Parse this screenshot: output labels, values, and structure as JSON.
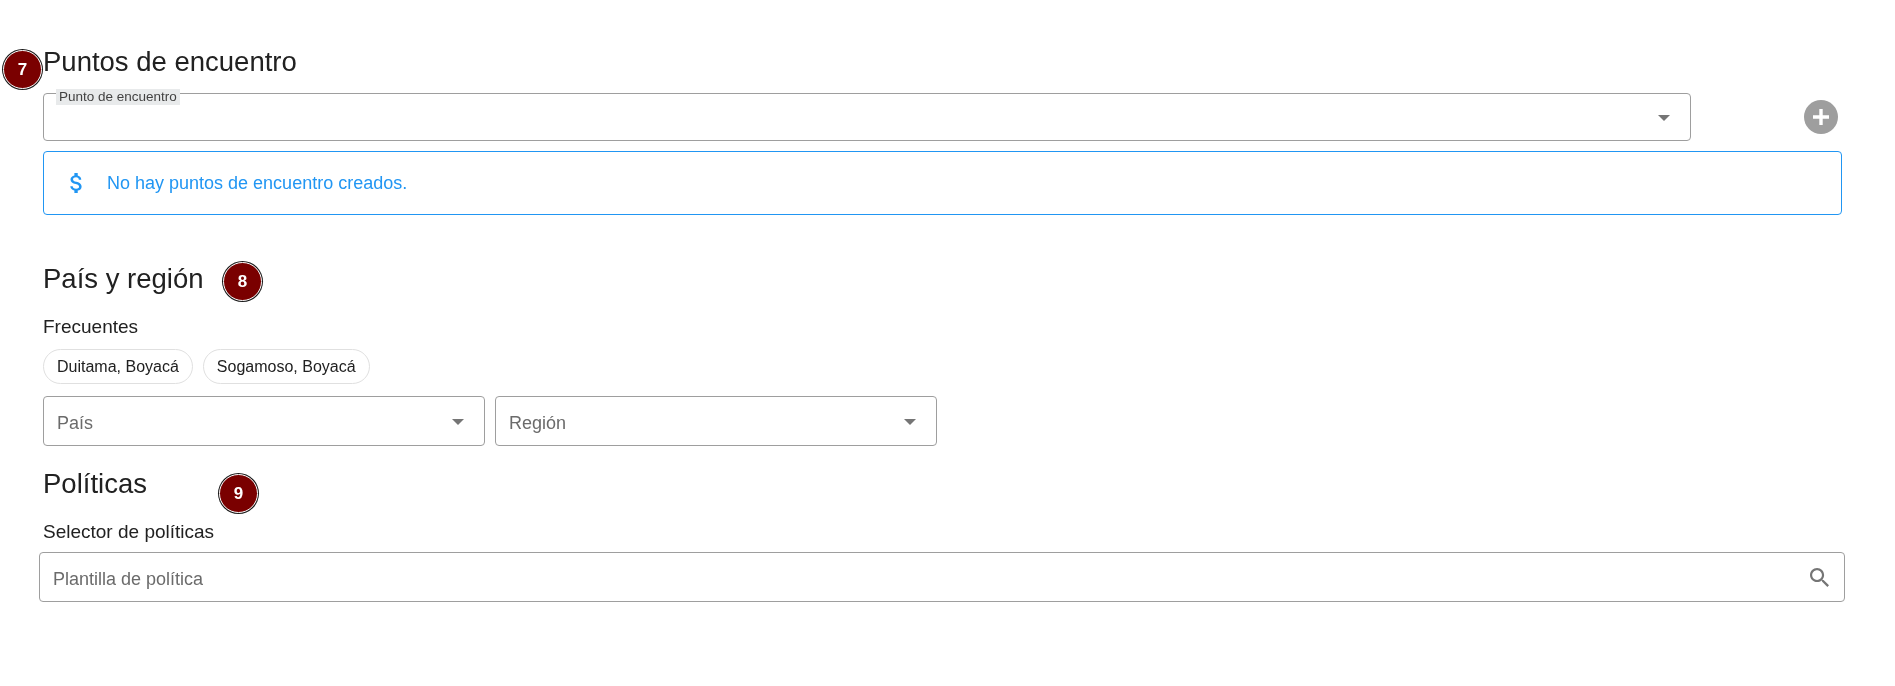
{
  "meeting_points": {
    "marker": "7",
    "title": "Puntos de encuentro",
    "field": {
      "label": "Punto de encuentro"
    },
    "alert": {
      "text": "No hay puntos de encuentro creados."
    }
  },
  "country_region": {
    "marker": "8",
    "title": "País y región",
    "frequent": {
      "label": "Frecuentes",
      "chips": [
        "Duitama, Boyacá",
        "Sogamoso, Boyacá"
      ]
    },
    "fields": [
      {
        "placeholder": "País"
      },
      {
        "placeholder": "Región"
      }
    ]
  },
  "policies": {
    "marker": "9",
    "title": "Políticas",
    "label": "Selector de políticas",
    "search": {
      "placeholder": "Plantilla de política"
    }
  }
}
